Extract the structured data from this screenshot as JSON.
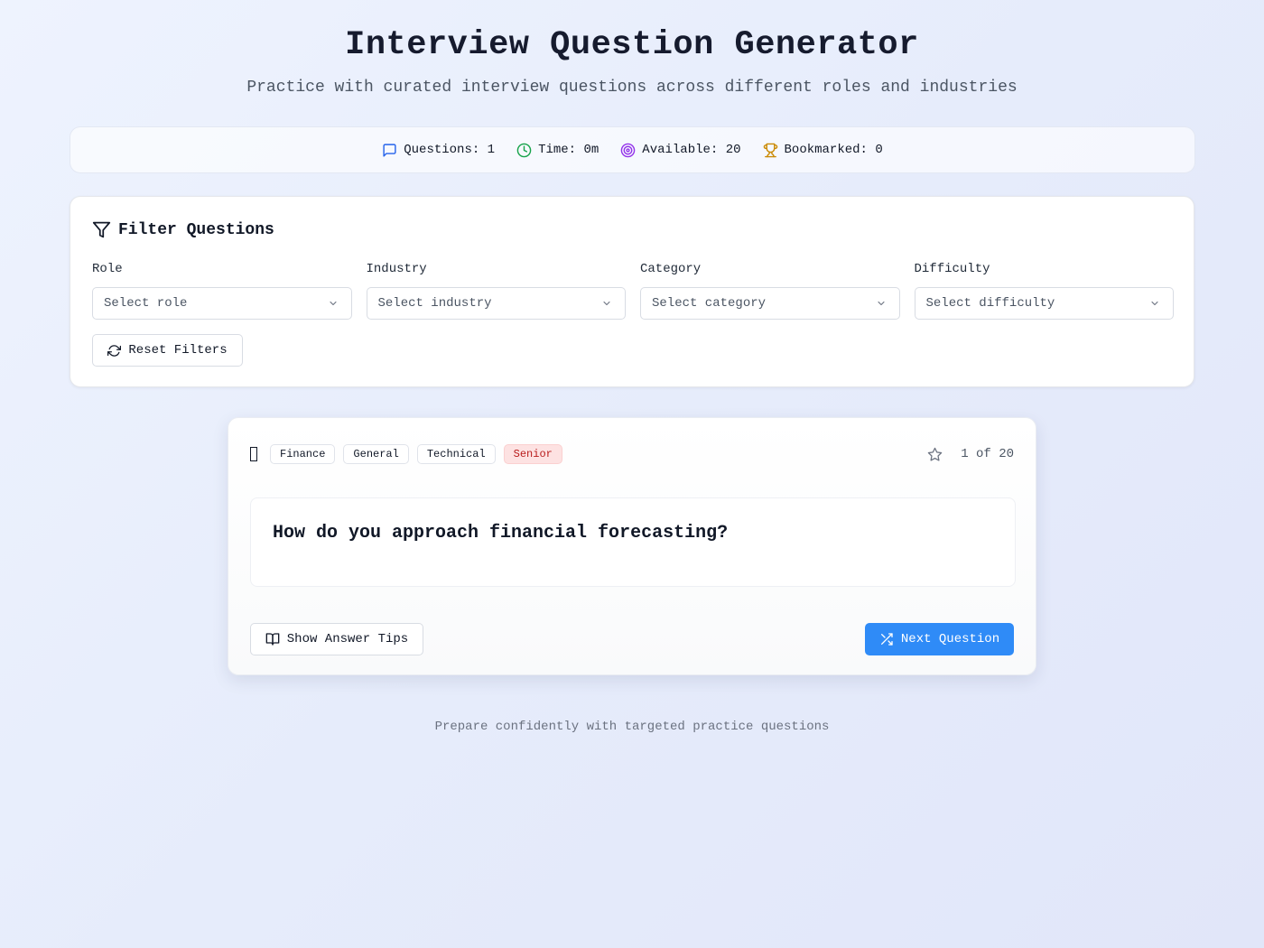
{
  "header": {
    "title": "Interview Question Generator",
    "subtitle": "Practice with curated interview questions across different roles and industries"
  },
  "stats": [
    {
      "icon": "message-icon",
      "text": "Questions: 1",
      "color": "#2563eb"
    },
    {
      "icon": "clock-icon",
      "text": "Time: 0m",
      "color": "#16a34a"
    },
    {
      "icon": "target-icon",
      "text": "Available: 20",
      "color": "#9333ea"
    },
    {
      "icon": "trophy-icon",
      "text": "Bookmarked: 0",
      "color": "#ca8a04"
    }
  ],
  "filters": {
    "title": "Filter Questions",
    "fields": [
      {
        "label": "Role",
        "placeholder": "Select role"
      },
      {
        "label": "Industry",
        "placeholder": "Select industry"
      },
      {
        "label": "Category",
        "placeholder": "Select category"
      },
      {
        "label": "Difficulty",
        "placeholder": "Select difficulty"
      }
    ],
    "reset_label": "Reset Filters"
  },
  "question": {
    "tags": [
      "Finance",
      "General",
      "Technical",
      "Senior"
    ],
    "counter": "1 of 20",
    "text": "How do you approach financial forecasting?",
    "tips_label": "Show Answer Tips",
    "next_label": "Next Question"
  },
  "footer": {
    "text": "Prepare confidently with targeted practice questions"
  },
  "colors": {
    "accent": "#2f8bf7",
    "senior_badge_bg": "#fde2e2",
    "senior_badge_text": "#b91c1c"
  }
}
